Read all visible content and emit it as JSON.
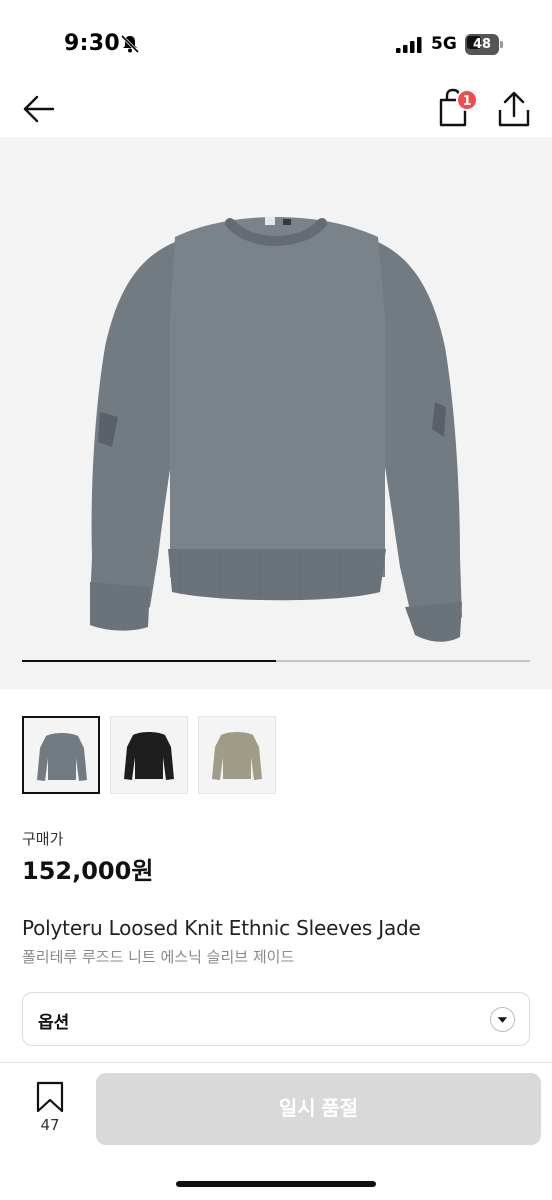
{
  "status_bar": {
    "time": "9:30",
    "network": "5G",
    "battery_level": "48",
    "battery_fraction": 0.48
  },
  "nav": {
    "back_icon": "arrow-left-icon",
    "cart_icon": "shopping-bag-icon",
    "cart_badge": "1",
    "share_icon": "share-upload-icon"
  },
  "gallery": {
    "image_count": 2,
    "current_index": 1,
    "progress_fraction": 0.5,
    "thumbnails": [
      {
        "label": "grey",
        "color": "#737b82",
        "selected": true
      },
      {
        "label": "black",
        "color": "#1e1e1e",
        "selected": false
      },
      {
        "label": "olive",
        "color": "#a09c87",
        "selected": false
      }
    ]
  },
  "price": {
    "label": "구매가",
    "value": "152,000원"
  },
  "product": {
    "title_en": "Polyteru Loosed Knit Ethnic Sleeves Jade",
    "title_ko": "폴리테루 루즈드 니트 에스닉 슬리브 제이드"
  },
  "option": {
    "label": "옵션"
  },
  "bottom_bar": {
    "bookmark_count": "47",
    "action_label": "일시 품절"
  },
  "colors": {
    "badge": "#ef4d4d",
    "disabled_button": "#d9d9d9",
    "sweater": "#737b82"
  }
}
